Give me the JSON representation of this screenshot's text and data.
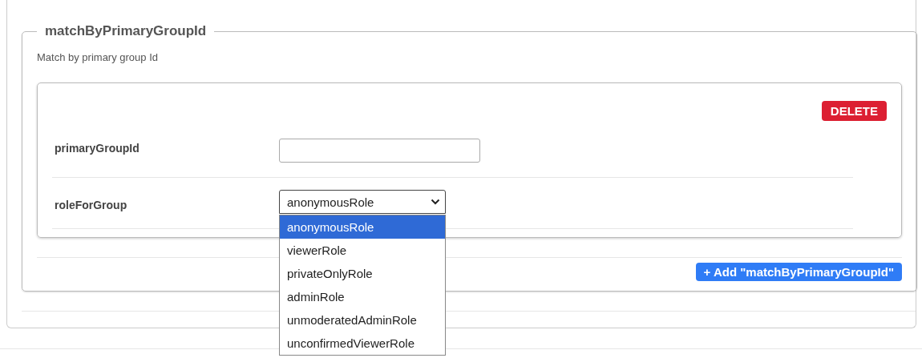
{
  "fieldset": {
    "legend": "matchByPrimaryGroupId",
    "description": "Match by primary group Id"
  },
  "item": {
    "delete_button": "DELETE",
    "fields": [
      {
        "kind": "text",
        "label": "primaryGroupId"
      },
      {
        "kind": "select",
        "label": "roleForGroup",
        "value": "anonymousRole",
        "expanded": true,
        "options": [
          {
            "label": "anonymousRole",
            "selected": true
          },
          {
            "label": "viewerRole",
            "selected": false
          },
          {
            "label": "privateOnlyRole",
            "selected": false
          },
          {
            "label": "adminRole",
            "selected": false
          },
          {
            "label": "unmoderatedAdminRole",
            "selected": false
          },
          {
            "label": "unconfirmedViewerRole",
            "selected": false
          }
        ]
      }
    ]
  },
  "add_button": "+ Add \"matchByPrimaryGroupId\""
}
